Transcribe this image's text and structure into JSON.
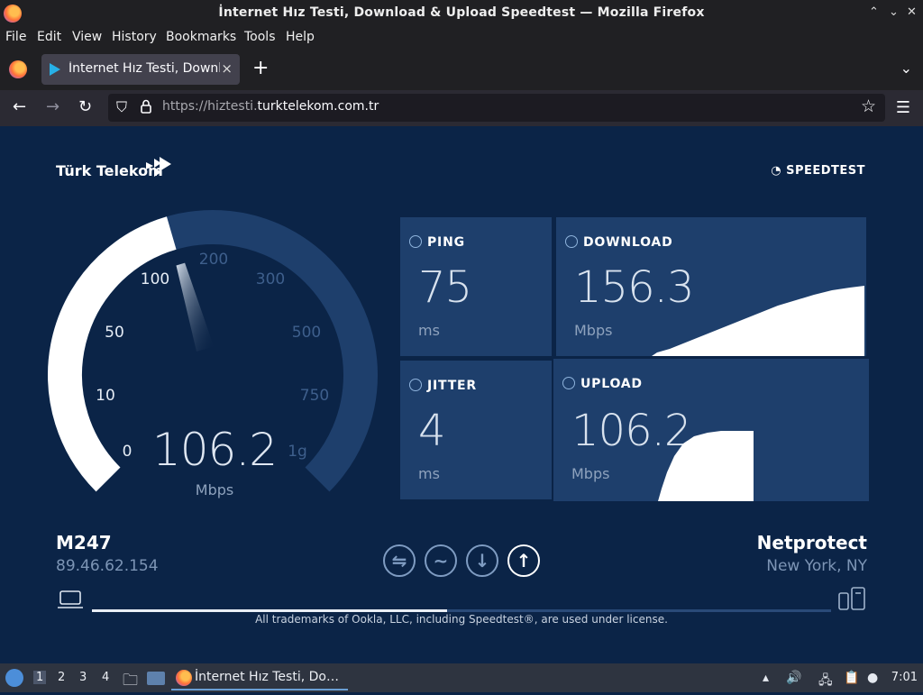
{
  "window": {
    "title": "İnternet Hız Testi, Download & Upload Speedtest — Mozilla Firefox"
  },
  "menubar": [
    "File",
    "Edit",
    "View",
    "History",
    "Bookmarks",
    "Tools",
    "Help"
  ],
  "tab": {
    "label": "İnternet Hız Testi, Download & Upload Speedtest",
    "close": "×",
    "new_tab": "+"
  },
  "urlbar": {
    "prefix": "https://hiztesti.",
    "domain": "turktelekom.com.tr"
  },
  "page": {
    "brand": "Türk Telekom",
    "speedtest_label": "SPEEDTEST",
    "gauge": {
      "ticks": [
        "0",
        "10",
        "50",
        "100",
        "200",
        "300",
        "500",
        "750",
        "1g"
      ],
      "value": "106.2",
      "unit": "Mbps",
      "level_fraction": 0.44
    },
    "ping": {
      "label": "PING",
      "value": "75",
      "unit": "ms"
    },
    "download": {
      "label": "DOWNLOAD",
      "value": "156.3",
      "unit": "Mbps"
    },
    "jitter": {
      "label": "JITTER",
      "value": "4",
      "unit": "ms"
    },
    "upload": {
      "label": "UPLOAD",
      "value": "106.2",
      "unit": "Mbps"
    },
    "isp": {
      "name": "M247",
      "ip": "89.46.62.154"
    },
    "server": {
      "name": "Netprotect",
      "location": "New York, NY"
    },
    "progress_fraction": 0.48,
    "trademark": "All trademarks of Ookla, LLC, including Speedtest®, are used under license."
  },
  "taskbar": {
    "workspaces": [
      "1",
      "2",
      "3",
      "4"
    ],
    "app_label": "İnternet Hız Testi, Do…",
    "clock": "7:01"
  },
  "colors": {
    "page_bg": "#0b2447",
    "panel_bg": "#1e3f6c",
    "accent": "#ffffff",
    "muted": "#8ea2bd"
  }
}
